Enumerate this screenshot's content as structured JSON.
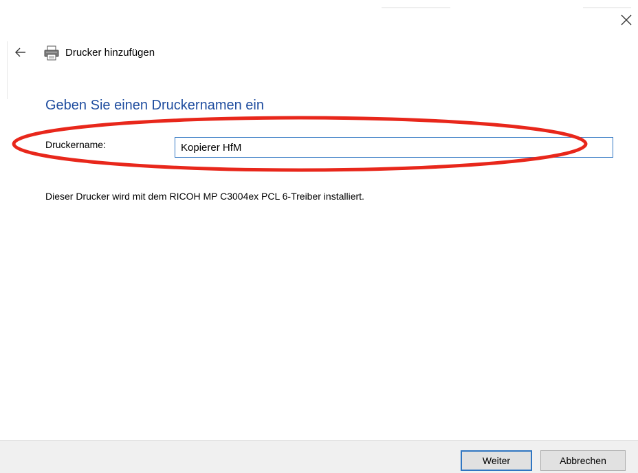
{
  "wizard": {
    "title": "Drucker hinzufügen",
    "heading": "Geben Sie einen Druckernamen ein"
  },
  "form": {
    "printer_name_label": "Druckername:",
    "printer_name_value": "Kopierer HfM"
  },
  "info": {
    "driver_text": "Dieser Drucker wird mit dem RICOH MP C3004ex PCL 6-Treiber installiert."
  },
  "buttons": {
    "next_label": "Weiter",
    "cancel_label": "Abbrechen"
  },
  "icons": {
    "close": "close-icon",
    "back": "back-arrow-icon",
    "printer": "printer-icon"
  },
  "colors": {
    "heading": "#1f4d9f",
    "input_border": "#2f76c2",
    "annotation": "#e8271b",
    "footer_bg": "#f0f0f0"
  }
}
